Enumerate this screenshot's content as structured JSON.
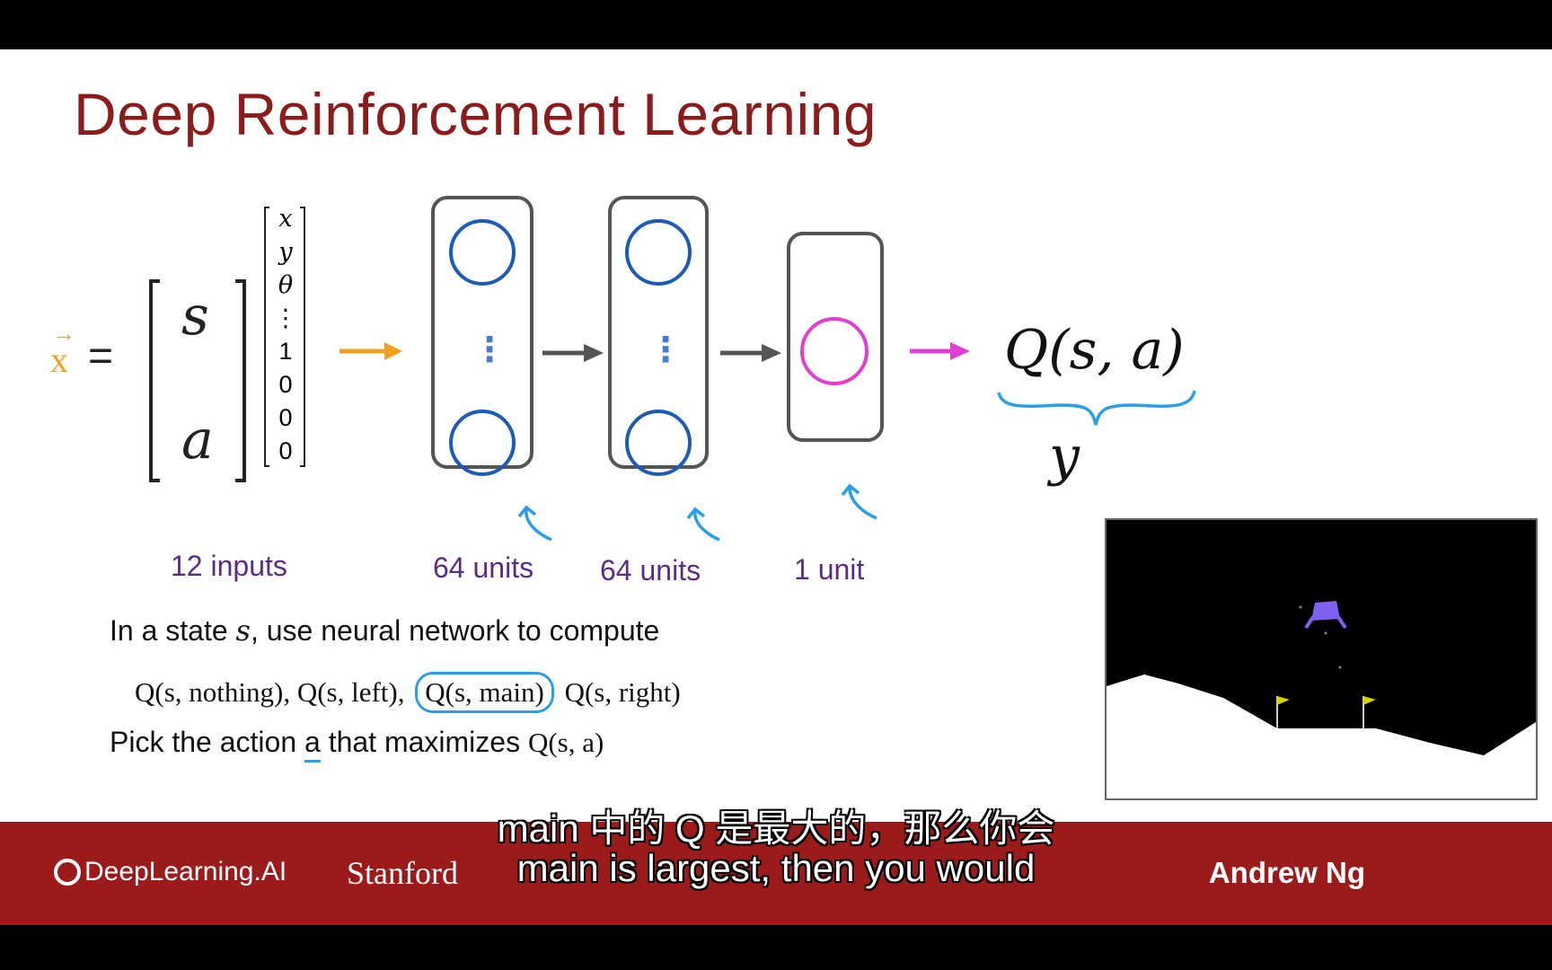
{
  "slide": {
    "title": "Deep Reinforcement Learning",
    "equation": {
      "vec": "x",
      "equals": "=",
      "state": "s",
      "action": "a"
    },
    "input_vector": [
      "x",
      "y",
      "θ",
      "⋮",
      "1",
      "0",
      "0",
      "0"
    ],
    "layer_dots": "⋮",
    "output": {
      "lhs": "Q(s, a)",
      "target": "y"
    },
    "labels": {
      "inputs": "12 inputs",
      "layer1": "64 units",
      "layer2": "64 units",
      "layer3": "1 unit"
    },
    "text": {
      "line1_prefix": "In a state",
      "line1_var": "s",
      "line1_suffix": ", use neural network to compute",
      "q_nothing": "Q(s, nothing),",
      "q_left": "Q(s, left),",
      "q_main": "Q(s, main)",
      "q_right": "Q(s, right)",
      "line3_prefix": "Pick the action",
      "line3_var": "a",
      "line3_mid": "that maximizes",
      "line3_q": "Q(s, a)"
    },
    "colors": {
      "title": "#8b1c1c",
      "orange": "#f0a020",
      "pink": "#e040d0",
      "blue": "#1e5bb5",
      "annot": "#2a9ee8",
      "label": "#5a2d82"
    }
  },
  "footer": {
    "brand": "DeepLearning.AI",
    "university": "Stanford",
    "author": "Andrew Ng"
  },
  "subtitles": {
    "zh": "main 中的 Q 是最大的，那么你会",
    "en": "main is largest, then you would"
  }
}
